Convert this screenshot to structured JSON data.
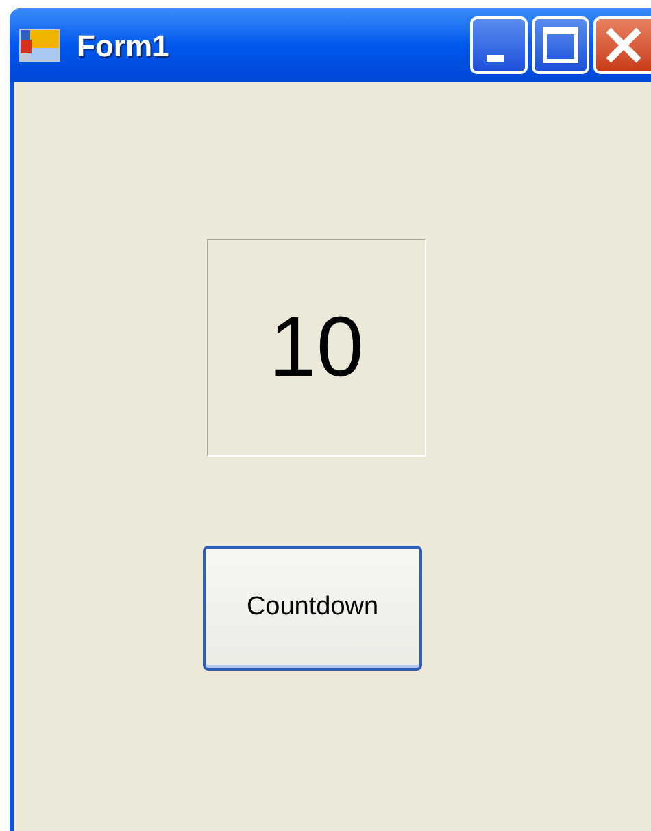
{
  "window": {
    "title": "Form1"
  },
  "counter_label": {
    "text": "10"
  },
  "buttons": [
    {
      "label": "Countdown"
    }
  ]
}
